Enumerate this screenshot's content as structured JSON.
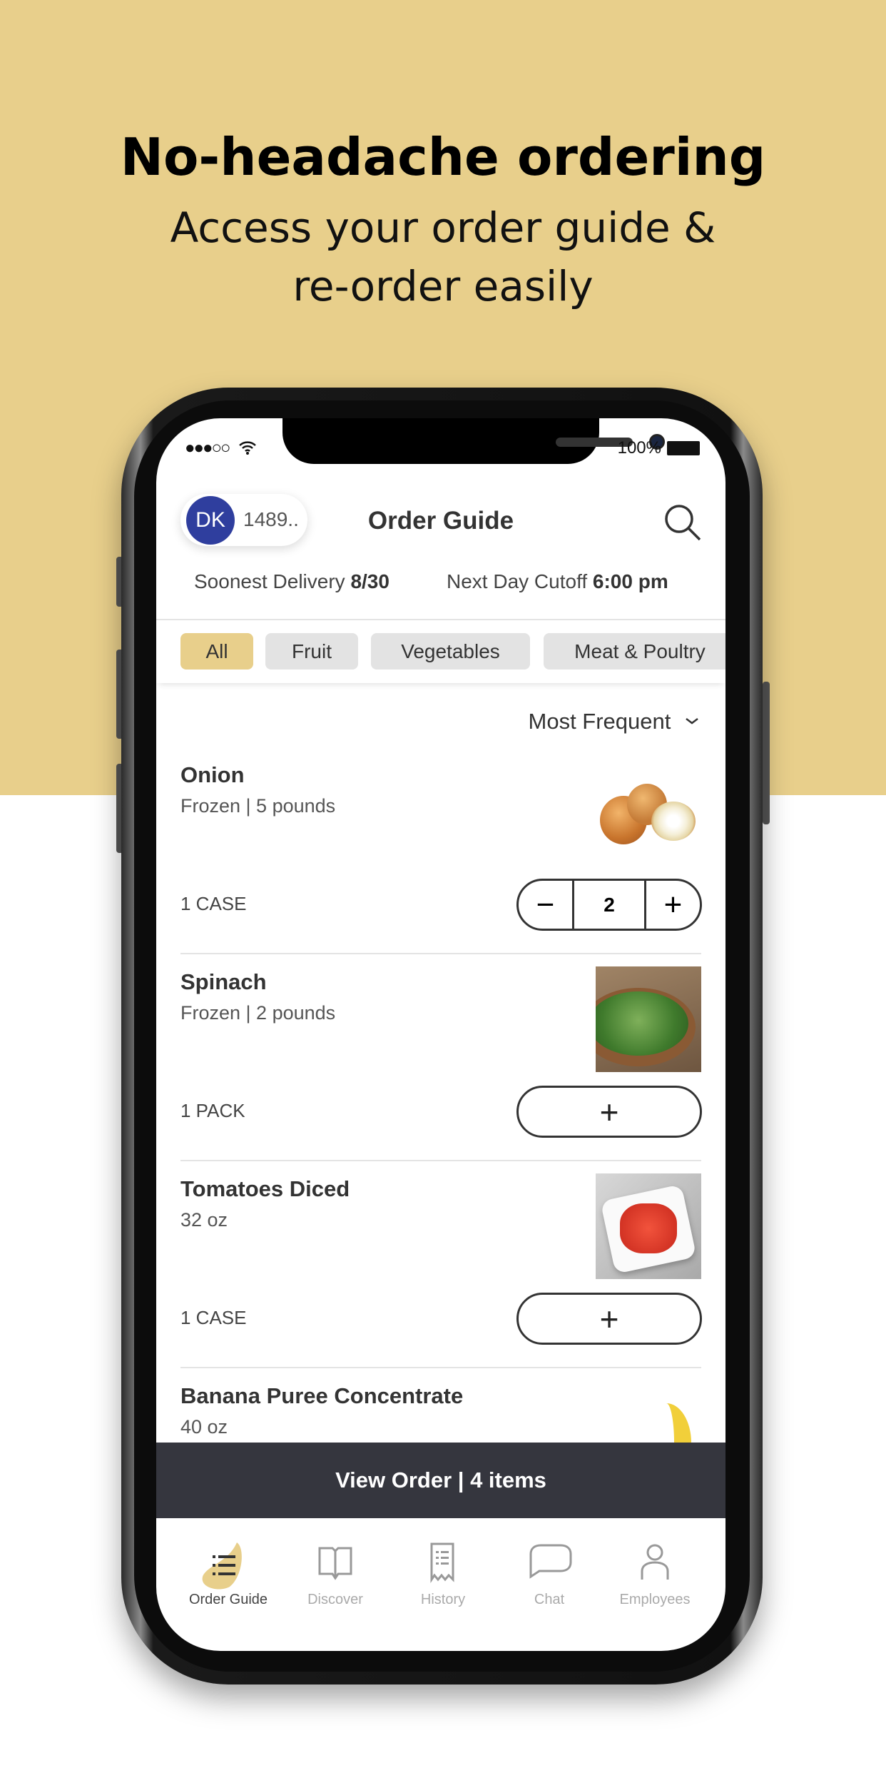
{
  "hero": {
    "title": "No-headache ordering",
    "subtitle_line1": "Access your order guide &",
    "subtitle_line2": "re-order easily",
    "background_color": "#e8cf8b"
  },
  "status_bar": {
    "signal": "●●●○○",
    "battery": "100%"
  },
  "header": {
    "avatar_initials": "DK",
    "account": "1489..",
    "title": "Order Guide",
    "search_icon": "search-icon"
  },
  "delivery": {
    "soonest_label": "Soonest Delivery",
    "soonest_value": "8/30",
    "cutoff_label": "Next Day Cutoff",
    "cutoff_value": "6:00 pm"
  },
  "categories": [
    {
      "label": "All",
      "selected": true
    },
    {
      "label": "Fruit"
    },
    {
      "label": "Vegetables"
    },
    {
      "label": "Meat & Poultry"
    }
  ],
  "sort": {
    "label": "Most Frequent"
  },
  "items": [
    {
      "name": "Onion",
      "detail": "Frozen | 5 pounds",
      "unit": "1 CASE",
      "quantity": "2"
    },
    {
      "name": "Spinach",
      "detail": "Frozen | 2 pounds",
      "unit": "1 PACK"
    },
    {
      "name": "Tomatoes Diced",
      "detail": "32 oz",
      "unit": "1 CASE"
    },
    {
      "name": "Banana Puree Concentrate",
      "detail": "40 oz"
    }
  ],
  "view_order": {
    "label": "View Order | 4 items",
    "color": "#35363e"
  },
  "tabs": [
    {
      "label": "Order Guide",
      "active": true
    },
    {
      "label": "Discover"
    },
    {
      "label": "History"
    },
    {
      "label": "Chat"
    },
    {
      "label": "Employees"
    }
  ],
  "accent_color": "#e8cf8b"
}
